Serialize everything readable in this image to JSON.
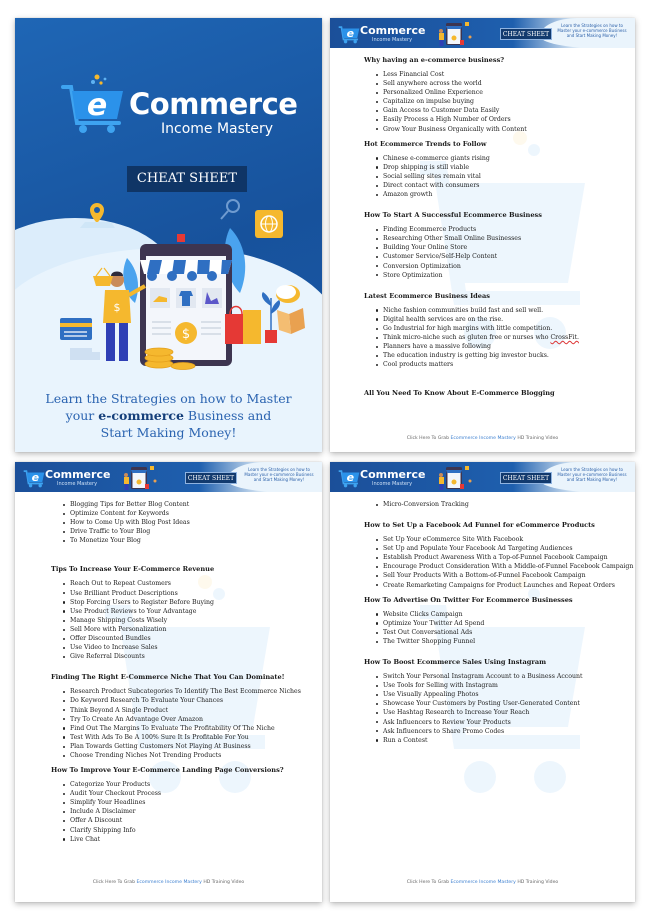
{
  "brand": {
    "logo_letter": "e",
    "title": "Commerce",
    "subtitle": "Income Mastery",
    "badge": "CHEAT SHEET",
    "colors": {
      "primary": "#1a5aa8",
      "dark": "#0f3566",
      "light": "#e9f4fd",
      "accent": "#f5b82e",
      "red": "#e53935"
    }
  },
  "cover": {
    "tagline_line1": "Learn the Strategies on how to Master",
    "tagline_line2_pre": "your ",
    "tagline_line2_bold": "e-commerce",
    "tagline_line2_post": " Business and",
    "tagline_line3": "Start Making Money!",
    "icons": [
      "cart-icon",
      "map-pin-icon",
      "search-icon",
      "globe-icon",
      "dollar-coin-icon",
      "storefront-icon",
      "shopping-bag-icon",
      "gift-box-icon",
      "credit-card-icon",
      "chat-bubble-icon",
      "basket-icon",
      "truck-icon"
    ]
  },
  "header": {
    "tagline": "Learn the Strategies on how to Master your e-commerce Business and Start Making Money!"
  },
  "footer": {
    "pre": "Click Here To Grab ",
    "link": "Ecommerce Income Mastery",
    "post": " HD Training Video"
  },
  "page2": {
    "sections": [
      {
        "title": "Why having an e-commerce business?",
        "items": [
          "Less Financial Cost",
          "Sell anywhere across the world",
          "Personalized Online Experience",
          "Capitalize on impulse buying",
          "Gain Access to Customer Data Easily",
          "Easily Process a High Number of Orders",
          "Grow Your Business Organically with Content"
        ]
      },
      {
        "title": "Hot Ecommerce  Trends to Follow",
        "items": [
          "Chinese e-commerce giants rising",
          "Drop shipping is still viable",
          "Social selling sites remain vital",
          "Direct contact with consumers",
          "Amazon growth"
        ]
      },
      {
        "title": "How To Start A Successful Ecommerce  Business",
        "items": [
          "Finding Ecommerce Products",
          "Researching Other Small Online Businesses",
          "Building Your Online Store",
          "Customer Service/Self-Help Content",
          "Conversion Optimization",
          "Store Optimization"
        ]
      },
      {
        "title": "Latest Ecommerce Business Ideas",
        "items": [
          "Niche fashion communities build fast and sell well.",
          "Digital health services are on the rise.",
          "Go Industrial for high margins with little competition.",
          "Think micro-niche such as gluten free or nurses who ",
          "Planners have a massive following",
          "The education industry is getting big investor bucks.",
          "Cool products matters"
        ],
        "misspelled_word": "CrossFit."
      },
      {
        "title": "All You Need To Know About E-Commerce Blogging",
        "items": []
      }
    ]
  },
  "page3": {
    "lead_items": [
      "Blogging Tips for Better Blog Content",
      "Optimize Content for Keywords",
      "How to Come Up with Blog Post Ideas",
      "Drive Traffic to Your Blog",
      "To Monetize Your Blog"
    ],
    "sections": [
      {
        "title": "Tips To Increase Your E-Commerce Revenue",
        "items": [
          "Reach Out to Repeat Customers",
          "Use Brilliant Product Descriptions",
          "Stop Forcing Users to Register Before Buying",
          "Use Product Reviews to Your Advantage",
          "Manage Shipping Costs Wisely",
          "Sell More with Personalization",
          "Offer Discounted Bundles",
          "Use Video to Increase Sales",
          "Give Referral Discounts"
        ]
      },
      {
        "title": "Finding The Right E-Commerce Niche That You Can Dominate!",
        "items": [
          "Research Product Subcategories To Identify The Best Ecommerce Niches",
          "Do Keyword Research To Evaluate Your Chances",
          "Think Beyond A Single Product",
          "Try To Create An Advantage Over Amazon",
          "Find Out The Margins To Evaluate The Profitability Of The Niche",
          "Test With Ads To Be A 100% Sure It Is Profitable For You",
          "Plan Towards Getting Customers Not Playing At Business",
          "Choose Trending Niches Not Trending Products"
        ]
      },
      {
        "title": "How To Improve Your E-Commerce  Landing Page Conversions?",
        "items": [
          "Categorize Your Products",
          "Audit Your Checkout Process",
          "Simplify Your Headlines",
          "Include A Disclaimer",
          "Offer A Discount",
          "Clarify Shipping Info",
          "Live Chat"
        ]
      }
    ]
  },
  "page4": {
    "lead_items": [
      "Micro-Conversion Tracking"
    ],
    "sections": [
      {
        "title": "How to Set Up a Facebook Ad Funnel for eCommerce Products",
        "items": [
          "Set Up Your eCommerce Site With Facebook",
          "Set Up and Populate Your Facebook Ad Targeting Audiences",
          "Establish Product Awareness With a Top-of-Funnel Facebook Campaign",
          "Encourage Product Consideration With a Middle-of-Funnel Facebook Campaign",
          "Sell Your Products With a Bottom-of-Funnel Facebook Campaign",
          "Create Remarketing Campaigns for Product Launches and Repeat Orders"
        ]
      },
      {
        "title": "How To Advertise On Twitter For Ecommerce  Businesses",
        "items": [
          "Website Clicks Campaign",
          "Optimize Your Twitter  Ad Spend",
          "Test Out Conversational  Ads",
          "The Twitter Shopping Funnel"
        ]
      },
      {
        "title": "How To Boost Ecommerce  Sales Using Instagram",
        "items": [
          "Switch Your Personal Instagram Account to a Business Account",
          "Use Tools for Selling with Instagram",
          "Use Visually Appealing Photos",
          "Showcase Your Customers  by Posting  User-Generated Content",
          "Use Hashtag Research to Increase Your Reach",
          "Ask Influencers to Review Your Products",
          "Ask Influencers to Share Promo Codes",
          "Run a Contest"
        ]
      }
    ]
  }
}
